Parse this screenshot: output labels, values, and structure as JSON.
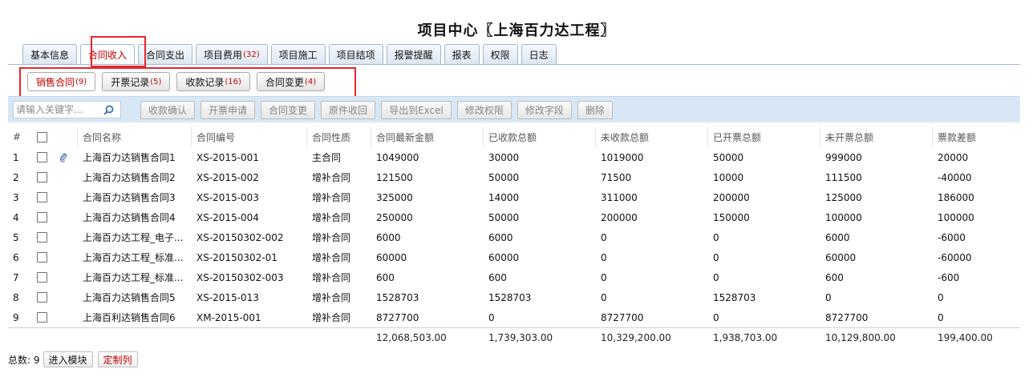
{
  "title": "项目中心〖上海百力达工程〗",
  "main_tabs": [
    {
      "label": "基本信息",
      "count": ""
    },
    {
      "label": "合同收入",
      "count": ""
    },
    {
      "label": "合同支出",
      "count": ""
    },
    {
      "label": "项目费用",
      "count": "(32)"
    },
    {
      "label": "项目施工",
      "count": ""
    },
    {
      "label": "项目结项",
      "count": ""
    },
    {
      "label": "报警提醒",
      "count": ""
    },
    {
      "label": "报表",
      "count": ""
    },
    {
      "label": "权限",
      "count": ""
    },
    {
      "label": "日志",
      "count": ""
    }
  ],
  "sub_tabs": [
    {
      "label": "销售合同",
      "count": "(9)"
    },
    {
      "label": "开票记录",
      "count": "(5)"
    },
    {
      "label": "收款记录",
      "count": "(16)"
    },
    {
      "label": "合同变更",
      "count": "(4)"
    }
  ],
  "toolbar": {
    "search_placeholder": "请输入关键字...",
    "buttons": [
      "收款确认",
      "开票申请",
      "合同变更",
      "原件收回",
      "导出到Excel",
      "修改权限",
      "修改字段",
      "删除"
    ]
  },
  "columns": [
    "#",
    "合同名称",
    "合同编号",
    "合同性质",
    "合同最新金额",
    "已收款总额",
    "未收款总额",
    "已开票总额",
    "未开票总额",
    "票款差额"
  ],
  "rows": [
    {
      "idx": "1",
      "name": "上海百力达销售合同1",
      "code": "XS-2015-001",
      "type": "主合同",
      "total": "1049000",
      "received": "30000",
      "unreceived": "1019000",
      "invoiced": "50000",
      "uninvoiced": "999000",
      "diff": "20000",
      "attachment": true
    },
    {
      "idx": "2",
      "name": "上海百力达销售合同2",
      "code": "XS-2015-002",
      "type": "增补合同",
      "total": "121500",
      "received": "50000",
      "unreceived": "71500",
      "invoiced": "10000",
      "uninvoiced": "111500",
      "diff": "-40000",
      "attachment": false
    },
    {
      "idx": "3",
      "name": "上海百力达销售合同3",
      "code": "XS-2015-003",
      "type": "增补合同",
      "total": "325000",
      "received": "14000",
      "unreceived": "311000",
      "invoiced": "200000",
      "uninvoiced": "125000",
      "diff": "186000",
      "attachment": false
    },
    {
      "idx": "4",
      "name": "上海百力达销售合同4",
      "code": "XS-2015-004",
      "type": "增补合同",
      "total": "250000",
      "received": "50000",
      "unreceived": "200000",
      "invoiced": "150000",
      "uninvoiced": "100000",
      "diff": "100000",
      "attachment": false
    },
    {
      "idx": "5",
      "name": "上海百力达工程_电子...",
      "code": "XS-20150302-002",
      "type": "增补合同",
      "total": "6000",
      "received": "6000",
      "unreceived": "0",
      "invoiced": "0",
      "uninvoiced": "6000",
      "diff": "-6000",
      "attachment": false
    },
    {
      "idx": "6",
      "name": "上海百力达工程_标准...",
      "code": "XS-20150302-01",
      "type": "增补合同",
      "total": "60000",
      "received": "60000",
      "unreceived": "0",
      "invoiced": "0",
      "uninvoiced": "60000",
      "diff": "-60000",
      "attachment": false
    },
    {
      "idx": "7",
      "name": "上海百力达工程_标准...",
      "code": "XS-20150302-003",
      "type": "增补合同",
      "total": "600",
      "received": "600",
      "unreceived": "0",
      "invoiced": "0",
      "uninvoiced": "600",
      "diff": "-600",
      "attachment": false
    },
    {
      "idx": "8",
      "name": "上海百力达销售合同5",
      "code": "XS-2015-013",
      "type": "增补合同",
      "total": "1528703",
      "received": "1528703",
      "unreceived": "0",
      "invoiced": "1528703",
      "uninvoiced": "0",
      "diff": "0",
      "attachment": false
    },
    {
      "idx": "9",
      "name": "上海百利达销售合同6",
      "code": "XM-2015-001",
      "type": "增补合同",
      "total": "8727700",
      "received": "0",
      "unreceived": "8727700",
      "invoiced": "0",
      "uninvoiced": "8727700",
      "diff": "0",
      "attachment": false
    }
  ],
  "totals": {
    "total": "12,068,503.00",
    "received": "1,739,303.00",
    "unreceived": "10,329,200.00",
    "invoiced": "1,938,703.00",
    "uninvoiced": "10,129,800.00",
    "diff": "199,400.00"
  },
  "footer": {
    "count_label": "总数:",
    "count_value": "9",
    "enter_module": "进入模块",
    "customize": "定制列"
  },
  "colors": {
    "accent_red": "#c00000",
    "highlight_box": "#e8262b",
    "toolbar_bg": "#d7e7f5",
    "tab_border": "#9fb6cf"
  }
}
